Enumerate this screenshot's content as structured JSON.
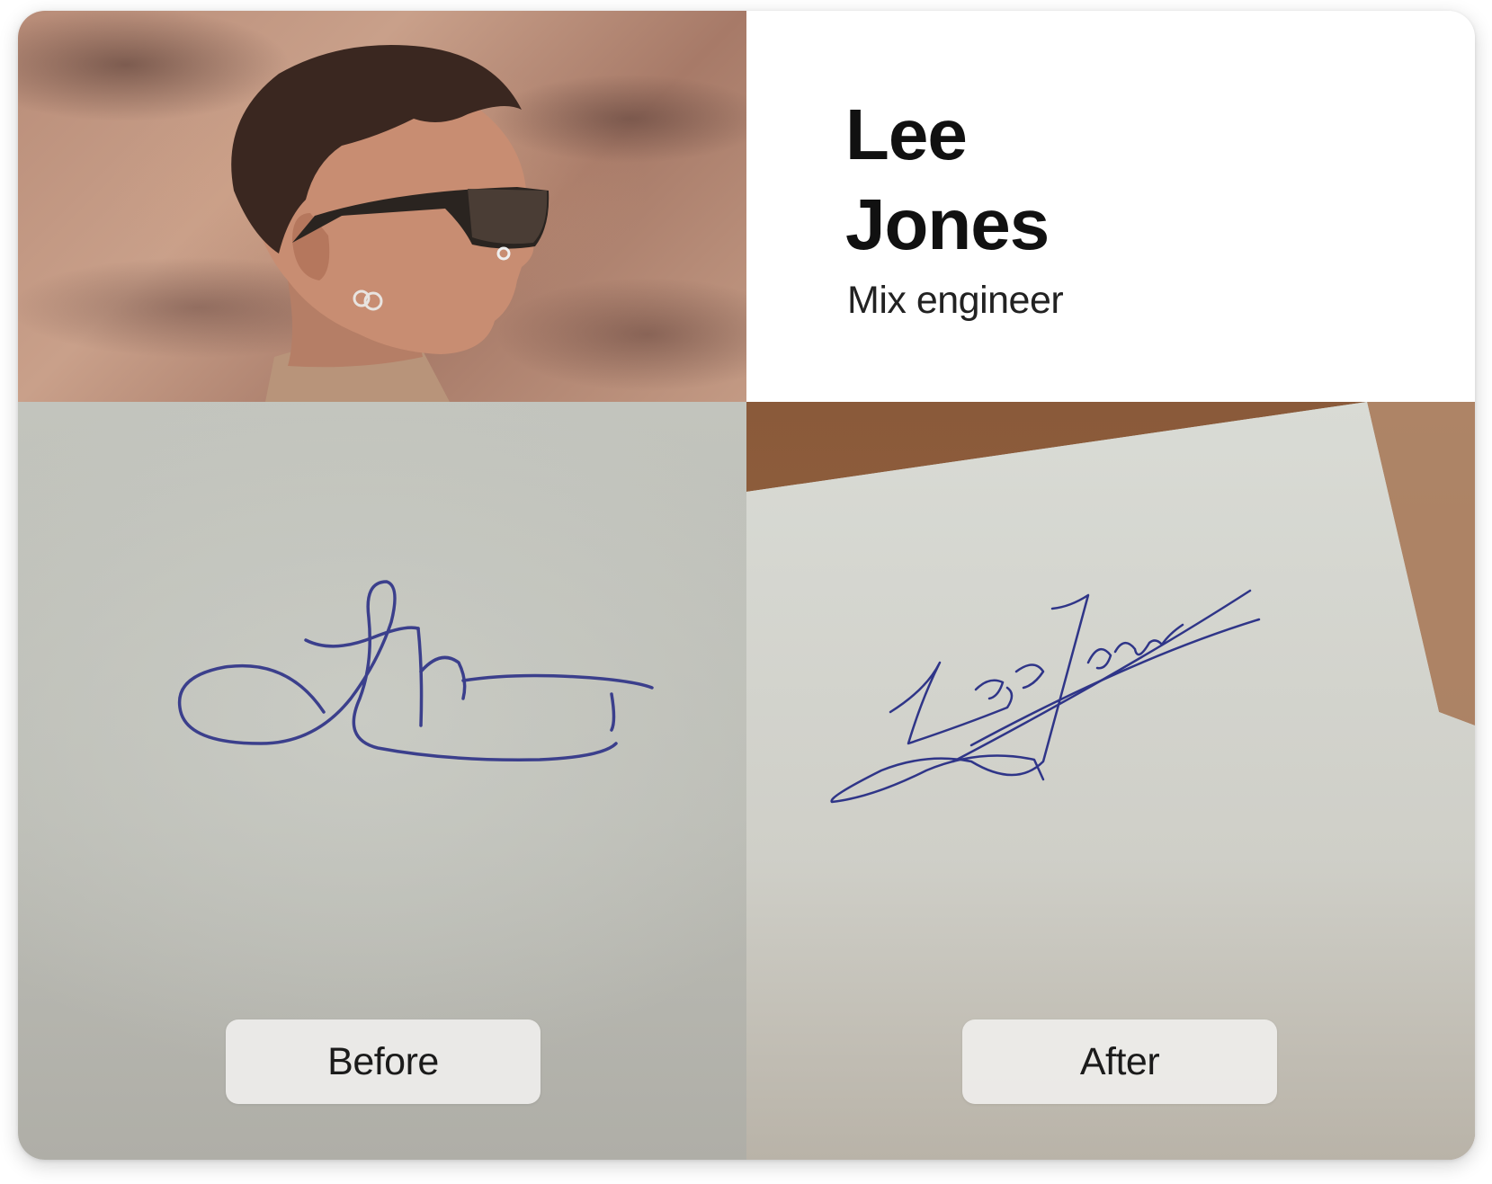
{
  "profile": {
    "first_name": "Lee",
    "last_name": "Jones",
    "role": "Mix engineer",
    "photo_icon": "portrait-photo"
  },
  "comparison": {
    "before_label": "Before",
    "after_label": "After",
    "before_signature_icon": "signature-before",
    "after_signature_icon": "signature-after"
  },
  "colors": {
    "ink": "#3a3a8a",
    "text": "#111111",
    "badge_bg": "#ecebe9"
  }
}
